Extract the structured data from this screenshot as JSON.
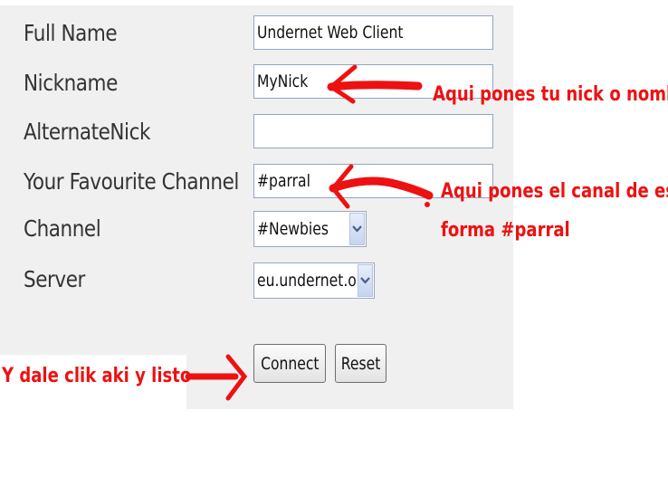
{
  "form": {
    "full_name_label": "Full Name",
    "full_name_value": "Undernet Web Client",
    "nickname_label": "Nickname",
    "nickname_value": "MyNick",
    "alternate_nick_label": "AlternateNick",
    "alternate_nick_value": "",
    "favourite_channel_label": "Your Favourite Channel",
    "favourite_channel_value": "#parral",
    "channel_label": "Channel",
    "channel_value": "#Newbies",
    "server_label": "Server",
    "server_value": "eu.undernet.org",
    "connect_label": "Connect",
    "reset_label": "Reset"
  },
  "annotations": {
    "nick_note": "Aqui pones tu nick o nombre",
    "channel_note_line1": "Aqui pones el canal de esta",
    "channel_note_line2": "forma #parral",
    "connect_note": "Y dale clik aki y listo",
    "color": "#ee1111"
  },
  "icons": [
    "chevron-down-icon",
    "red-arrow-icon"
  ]
}
